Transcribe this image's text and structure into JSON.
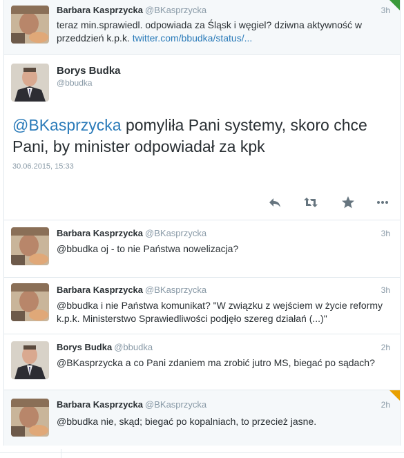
{
  "tweets_top": {
    "name": "Barbara Kasprzycka",
    "handle": "@BKasprzycka",
    "time": "3h",
    "text": "teraz min.sprawiedl. odpowiada za Śląsk i węgiel? dziwna aktywność w przeddzień k.p.k. ",
    "link": "twitter.com/bbudka/status/..."
  },
  "focus": {
    "name": "Borys Budka",
    "handle": "@bbudka",
    "mention": "@BKasprzycka",
    "text": " pomyliła Pani systemy, skoro chce Pani, by minister odpowiadał za kpk",
    "date": "30.06.2015, 15:33",
    "actions": [
      "reply-icon",
      "retweet-icon",
      "favorite-icon",
      "more-icon"
    ]
  },
  "replies": [
    {
      "name": "Barbara Kasprzycka",
      "handle": "@BKasprzycka",
      "time": "3h",
      "text": "@bbudka oj - to nie Państwa nowelizacja?"
    },
    {
      "name": "Barbara Kasprzycka",
      "handle": "@BKasprzycka",
      "time": "3h",
      "text": "@bbudka i nie Państwa komunikat? \"W związku z wejściem w życie reformy k.p.k. Ministerstwo Sprawiedliwości podjęło szereg działań (...)\""
    },
    {
      "name": "Borys Budka",
      "handle": "@bbudka",
      "time": "2h",
      "text": "@BKasprzycka a co Pani zdaniem ma zrobić jutro MS, biegać po sądach?"
    },
    {
      "name": "Barbara Kasprzycka",
      "handle": "@BKasprzycka",
      "time": "2h",
      "text": "@bbudka nie, skąd; biegać po kopalniach, to przecież jasne."
    }
  ],
  "colors": {
    "link": "#2b7bb9",
    "muted": "#8899a6",
    "border": "#e1e8ed",
    "corner_orange": "#e8a000",
    "corner_green": "#3a9a3a"
  }
}
